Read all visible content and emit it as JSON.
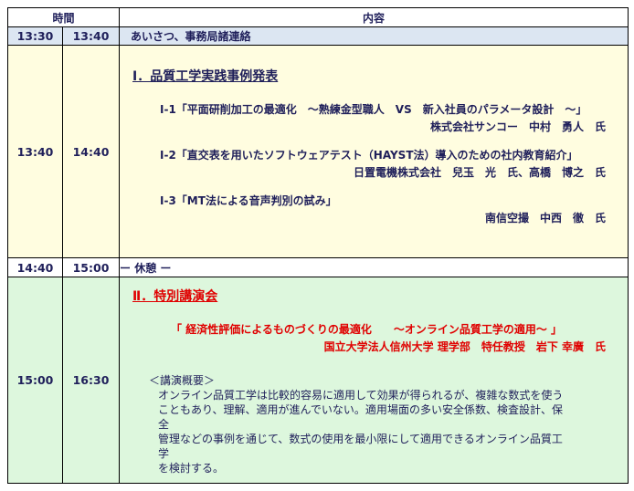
{
  "header": {
    "time": "時間",
    "content": "内容"
  },
  "rows": [
    {
      "start": "13:30",
      "end": "13:40",
      "content": "あいさつ、事務局諸連絡"
    },
    {
      "start": "13:40",
      "end": "14:40"
    },
    {
      "start": "14:40",
      "end": "15:00",
      "content": "ー 休憩 ー"
    },
    {
      "start": "15:00",
      "end": "16:30"
    }
  ],
  "section1": {
    "title": "Ⅰ．品質工学実践事例発表",
    "talks": [
      {
        "title": "Ⅰ-1「平面研削加工の最適化　～熟練金型職人　VS　新入社員のパラメータ設計　～」",
        "speaker": "株式会社サンコー　中村　勇人　氏"
      },
      {
        "title": "Ⅰ-2「直交表を用いたソフトウェアテスト（HAYST法）導入のための社内教育紹介」",
        "speaker": "日置電機株式会社　兒玉　光　氏、高橋　博之　氏"
      },
      {
        "title": "Ⅰ-3「MT法による音声判別の試み」",
        "speaker": "南信空撮　中西　徹　氏"
      }
    ]
  },
  "section2": {
    "title": "Ⅱ．特別講演会",
    "talk_title": "「 経済性評価によるものづくりの最適化　　～オンライン品質工学の適用～ 」",
    "speaker": "国立大学法人信州大学 理学部　特任教授　岩下 幸廣　氏",
    "overview_heading": "＜講演概要＞",
    "overview_lines": [
      "オンライン品質工学は比較的容易に適用して効果が得られるが、複雑な数式を使う",
      "こともあり、理解、適用が進んでいない。適用場面の多い安全係数、検査設計、保全",
      "管理などの事例を通じて、数式の使用を最小限にして適用できるオンライン品質工学",
      "を検討する。"
    ]
  }
}
